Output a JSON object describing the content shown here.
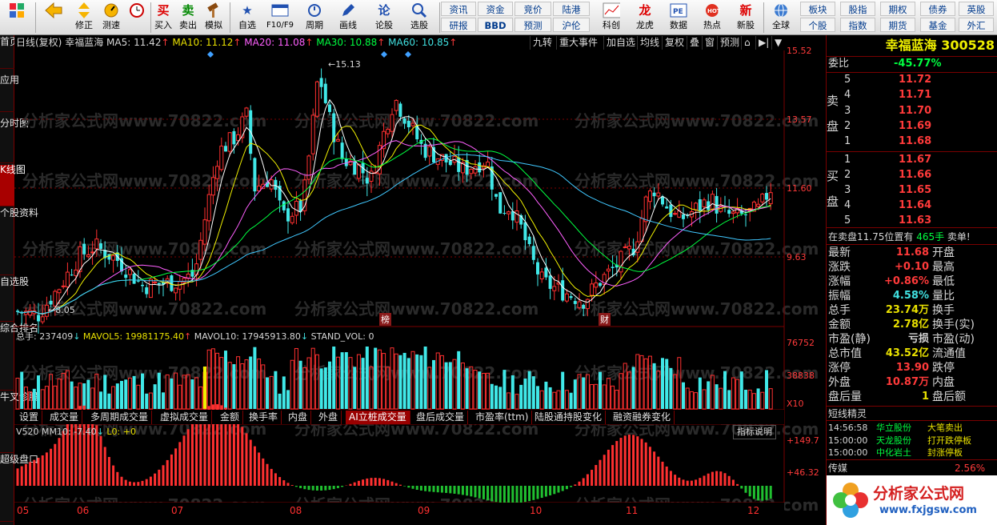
{
  "toolbar": {
    "buttons": [
      {
        "label": "",
        "icon": "grid-icon"
      },
      {
        "label": "",
        "icon": "back-arrow-icon"
      },
      {
        "label": "修正",
        "icon": "up-down-icon"
      },
      {
        "label": "测速",
        "icon": "speed-test-icon"
      },
      {
        "label": "",
        "icon": "clock-icon"
      },
      {
        "label": "买入",
        "icon": "buy-icon"
      },
      {
        "label": "卖出",
        "icon": "sell-icon"
      },
      {
        "label": "模拟",
        "icon": "hammer-icon"
      },
      {
        "label": "自选",
        "icon": "star-icon"
      },
      {
        "label": "F10/F9",
        "icon": "f10-icon"
      },
      {
        "label": "周期",
        "icon": "cycle-icon"
      },
      {
        "label": "画线",
        "icon": "pencil-icon"
      },
      {
        "label": "论股",
        "icon": "talk-icon"
      },
      {
        "label": "选股",
        "icon": "stock-pick-icon"
      },
      {
        "label": "",
        "icon": "chart-icon"
      },
      {
        "label": "科创",
        "icon": "star-market-icon"
      },
      {
        "label": "龙虎",
        "icon": "dragon-tiger-icon"
      },
      {
        "label": "数据",
        "icon": "pe-icon"
      },
      {
        "label": "热点",
        "icon": "hot-icon"
      },
      {
        "label": "新股",
        "icon": "new-stock-icon"
      },
      {
        "label": "全球",
        "icon": "globe-icon"
      }
    ],
    "text_buttons": [
      "资讯",
      "资金",
      "竞价",
      "陆港",
      "研报",
      "BBD",
      "预测",
      "沪伦",
      "板块",
      "股指",
      "期权",
      "债券",
      "英股",
      "个股",
      "指数",
      "期货",
      "基金",
      "外汇"
    ]
  },
  "leftbar": [
    "首页",
    "应用",
    "分时图",
    "K线图",
    "个股资料",
    "自选股",
    "综合排名",
    "牛叉诊股",
    "超级盘口"
  ],
  "chart_title": {
    "period": "日线(复权)",
    "name": "幸福蓝海",
    "ma5": "MA5: 11.42",
    "ma10": "MA10: 11.12",
    "ma20": "MA20: 11.08",
    "ma30": "MA30: 10.88",
    "ma60": "MA60: 10.85"
  },
  "chart_buttons": [
    "九转",
    "重大事件",
    "加自选",
    "均线",
    "复权",
    "叠",
    "窗",
    "预测"
  ],
  "price_axis": [
    "15.52",
    "13.57",
    "11.60",
    "9.63"
  ],
  "annotations": {
    "high": "15.13",
    "low": "8.05",
    "bang": "榜",
    "cai": "财"
  },
  "volume": {
    "header": {
      "total": "总手: 237409",
      "mavol5": "MAVOL5: 19981175.40",
      "mavol10": "MAVOL10: 17945913.80",
      "std": "STAND_VOL: 0"
    },
    "axis": [
      "76752",
      "38838",
      "X10"
    ]
  },
  "indicator_tabs": [
    "设置",
    "成交量",
    "多周期成交量",
    "虚拟成交量",
    "金额",
    "换手率",
    "内盘",
    "外盘",
    "AI立桩成交量",
    "盘后成交量",
    "市盈率(ttm)",
    "陆股通持股变化",
    "融资融券变化"
  ],
  "indicator_active": "AI立桩成交量",
  "indicator": {
    "header": {
      "name": "V520",
      "mm10": "MM10: -7.40",
      "l0": "L0: +0"
    },
    "button": "指标说明",
    "axis": [
      "+149.7",
      "+46.32"
    ]
  },
  "months": [
    "05",
    "06",
    "07",
    "08",
    "09",
    "10",
    "11",
    "12"
  ],
  "right_panel": {
    "stock_name": "幸福蓝海",
    "stock_code": "300528",
    "weibi_label": "委比",
    "weibi_value": "-45.77%",
    "sell_label": "卖\n盘",
    "sell": [
      {
        "level": "5",
        "price": "11.72"
      },
      {
        "level": "4",
        "price": "11.71"
      },
      {
        "level": "3",
        "price": "11.70"
      },
      {
        "level": "2",
        "price": "11.69"
      },
      {
        "level": "1",
        "price": "11.68"
      }
    ],
    "buy_label": "买\n盘",
    "buy": [
      {
        "level": "1",
        "price": "11.67"
      },
      {
        "level": "2",
        "price": "11.66"
      },
      {
        "level": "3",
        "price": "11.65"
      },
      {
        "level": "4",
        "price": "11.64"
      },
      {
        "level": "5",
        "price": "11.63"
      }
    ],
    "sell_note": {
      "text": "在卖盘11.75位置有",
      "qty": "465手",
      "tag": "卖单!"
    },
    "quote_left": [
      {
        "label": "最新",
        "value": "11.68",
        "color": "#ff3a3a"
      },
      {
        "label": "涨跌",
        "value": "+0.10",
        "color": "#ff3a3a"
      },
      {
        "label": "涨幅",
        "value": "+0.86%",
        "color": "#ff3a3a"
      },
      {
        "label": "振幅",
        "value": "4.58%",
        "color": "#40e0e0"
      },
      {
        "label": "总手",
        "value": "23.74万",
        "color": "#e8e000"
      },
      {
        "label": "金额",
        "value": "2.78亿",
        "color": "#e8e000"
      },
      {
        "label": "市盈(静)",
        "value": "亏损",
        "color": "#d7d7d7"
      },
      {
        "label": "总市值",
        "value": "43.52亿",
        "color": "#e8e000"
      },
      {
        "label": "涨停",
        "value": "13.90",
        "color": "#ff3a3a"
      },
      {
        "label": "外盘",
        "value": "10.87万",
        "color": "#ff3a3a"
      },
      {
        "label": "盘后量",
        "value": "1",
        "color": "#e8e000"
      }
    ],
    "quote_right": [
      "开盘",
      "最高",
      "最低",
      "量比",
      "换手",
      "换手(实)",
      "市盈(动)",
      "流通值",
      "跌停",
      "内盘",
      "盘后额"
    ],
    "news_header": "短线精灵",
    "news": [
      {
        "time": "14:56:58",
        "stock": "华立股份",
        "event": "大笔卖出"
      },
      {
        "time": "15:00:00",
        "stock": "天龙股份",
        "event": "打开跌停板"
      },
      {
        "time": "15:00:00",
        "stock": "中化岩土",
        "event": "封涨停板"
      }
    ],
    "footer": {
      "label": "传媒",
      "value": "2.56%"
    },
    "logo_text": "分析家公式网",
    "logo_url": "www.fxjgsw.com"
  },
  "watermark": "分析家公式网www.70822.com",
  "colors": {
    "up": "#ff3030",
    "down": "#40e8e8",
    "ma5": "#ffffff",
    "ma10": "#f0f000",
    "ma20": "#ff60ff",
    "ma30": "#00ff40",
    "ma60": "#40c8ff",
    "grid": "#7a0000"
  }
}
